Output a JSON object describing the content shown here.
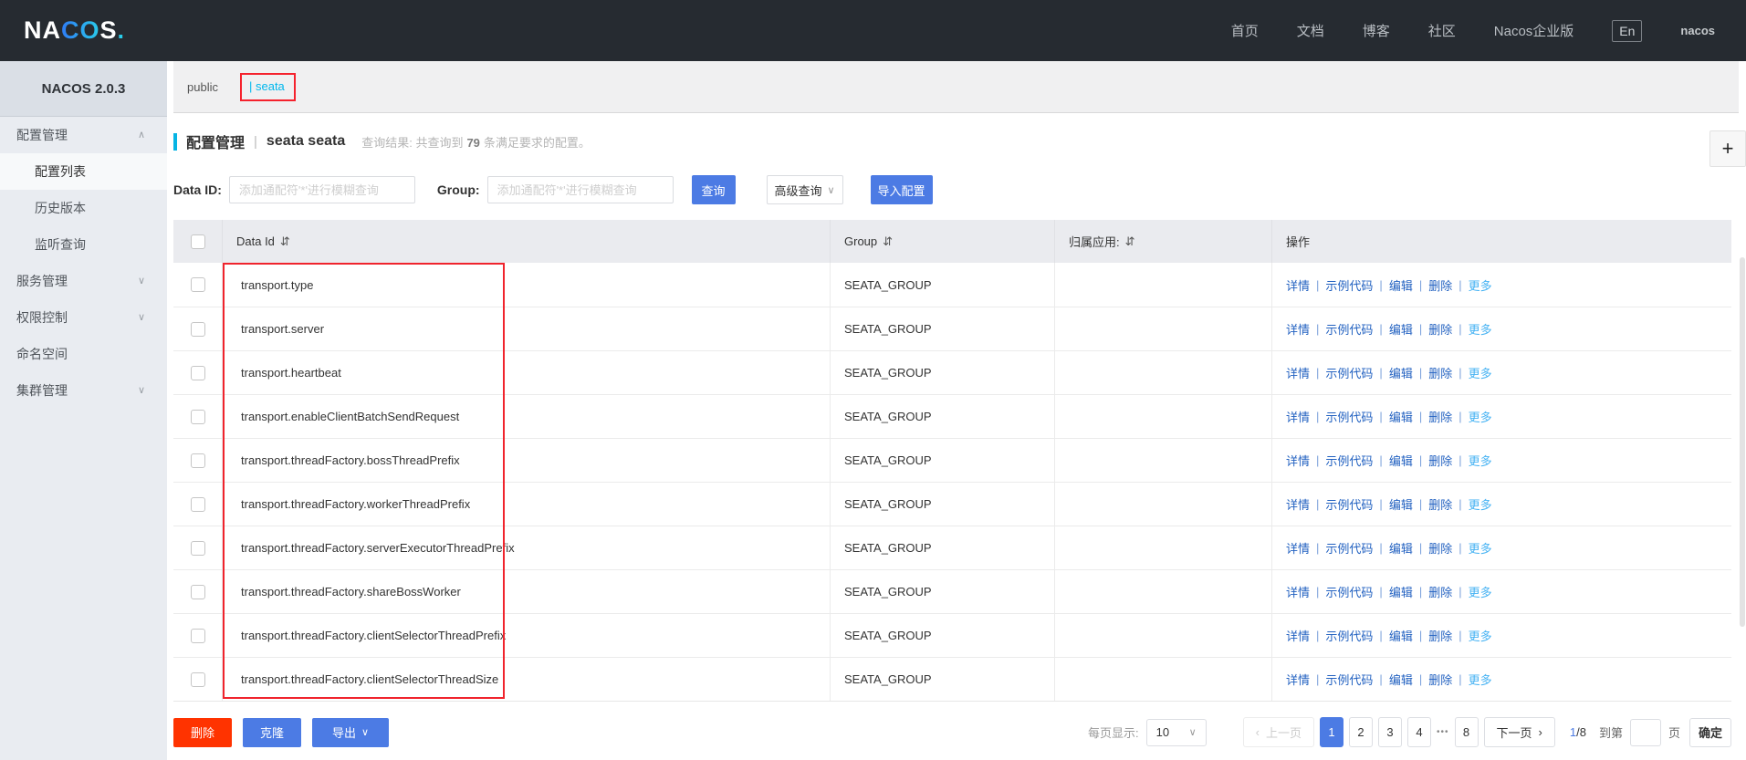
{
  "colors": {
    "navbar_bg": "#262b31",
    "primary_blue": "#4c7be4",
    "danger_red": "#ff3300",
    "link_blue": "#2362c1",
    "more_link_blue": "#45b2f3",
    "active_tab_cyan": "#00b7ed",
    "annotation_red": "#f0242d"
  },
  "navbar": {
    "logo": {
      "na": "NA",
      "co": "CO",
      "s": "S",
      "dot": "."
    },
    "items": [
      "首页",
      "文档",
      "博客",
      "社区",
      "Nacos企业版"
    ],
    "lang_badge": "En",
    "username": "nacos"
  },
  "sidebar": {
    "version": "NACOS 2.0.3",
    "items": [
      {
        "label": "配置管理",
        "caret": "∧"
      },
      {
        "label": "配置列表",
        "caret": ""
      },
      {
        "label": "历史版本",
        "caret": ""
      },
      {
        "label": "监听查询",
        "caret": ""
      },
      {
        "label": "服务管理",
        "caret": "∨"
      },
      {
        "label": "权限控制",
        "caret": "∨"
      },
      {
        "label": "命名空间",
        "caret": ""
      },
      {
        "label": "集群管理",
        "caret": "∨"
      }
    ]
  },
  "tabs": {
    "public": "public",
    "active_prefix": "|",
    "active": "seata"
  },
  "page": {
    "title": "配置管理",
    "separator": "|",
    "namespace": "seata seata",
    "result_prefix": "查询结果: 共查询到",
    "result_count": "79",
    "result_suffix": "条满足要求的配置。"
  },
  "search": {
    "data_id_label": "Data ID:",
    "group_label": "Group:",
    "data_id_placeholder": "添加通配符'*'进行模糊查询",
    "group_placeholder": "添加通配符'*'进行模糊查询",
    "query_button": "查询",
    "advanced_query_button": "高级查询",
    "import_button": "导入配置"
  },
  "icons": {
    "plus": "+",
    "caret_down": "∨",
    "caret_up": "∧",
    "sort": "⇵",
    "prev_arrow": "‹",
    "next_arrow": "›",
    "ellipsis": "•••"
  },
  "table": {
    "headers": {
      "data_id": "Data Id",
      "group": "Group",
      "app": "归属应用:",
      "actions": "操作"
    },
    "action_labels": [
      "详情",
      "示例代码",
      "编辑",
      "删除",
      "更多"
    ],
    "action_separator": "|",
    "rows": [
      {
        "data_id": "transport.type",
        "group": "SEATA_GROUP",
        "app": ""
      },
      {
        "data_id": "transport.server",
        "group": "SEATA_GROUP",
        "app": ""
      },
      {
        "data_id": "transport.heartbeat",
        "group": "SEATA_GROUP",
        "app": ""
      },
      {
        "data_id": "transport.enableClientBatchSendRequest",
        "group": "SEATA_GROUP",
        "app": ""
      },
      {
        "data_id": "transport.threadFactory.bossThreadPrefix",
        "group": "SEATA_GROUP",
        "app": ""
      },
      {
        "data_id": "transport.threadFactory.workerThreadPrefix",
        "group": "SEATA_GROUP",
        "app": ""
      },
      {
        "data_id": "transport.threadFactory.serverExecutorThreadPrefix",
        "group": "SEATA_GROUP",
        "app": ""
      },
      {
        "data_id": "transport.threadFactory.shareBossWorker",
        "group": "SEATA_GROUP",
        "app": ""
      },
      {
        "data_id": "transport.threadFactory.clientSelectorThreadPrefix",
        "group": "SEATA_GROUP",
        "app": ""
      },
      {
        "data_id": "transport.threadFactory.clientSelectorThreadSize",
        "group": "SEATA_GROUP",
        "app": ""
      }
    ]
  },
  "footer": {
    "delete_button": "删除",
    "clone_button": "克隆",
    "export_button": "导出",
    "page_size_label": "每页显示:",
    "page_size_value": "10",
    "prev_label": "上一页",
    "page_numbers": [
      "1",
      "2",
      "3",
      "4"
    ],
    "last_page": "8",
    "next_label": "下一页",
    "current_page": "1",
    "total_pages": "/8",
    "goto_label": "到第",
    "goto_unit": "页",
    "confirm_button": "确定"
  }
}
